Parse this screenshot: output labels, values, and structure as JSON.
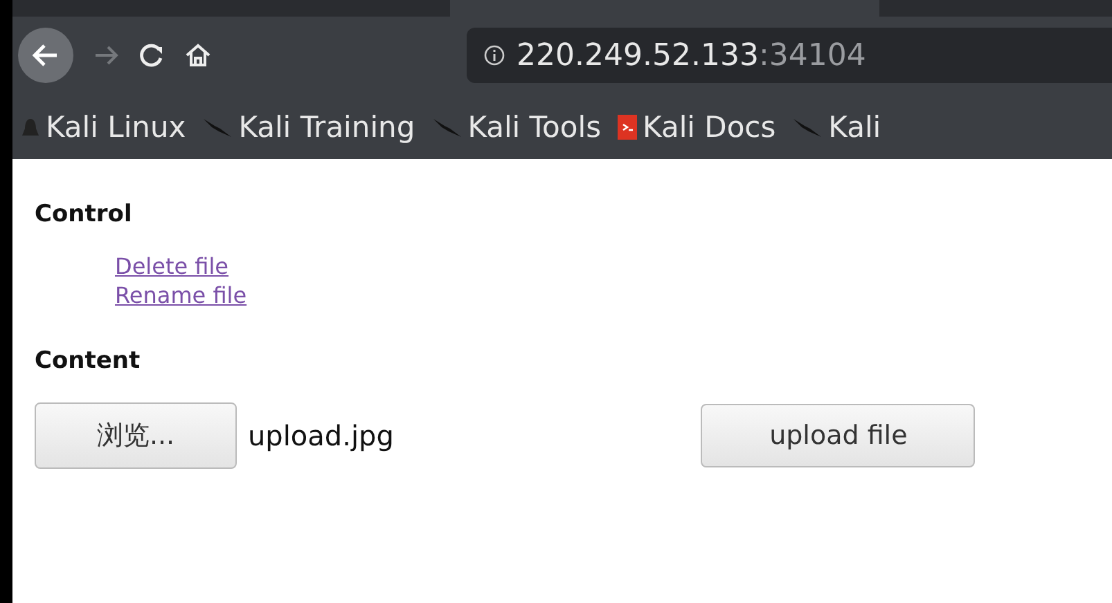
{
  "tabs": [
    {
      "selected": false
    },
    {
      "selected": true
    },
    {
      "selected": false
    }
  ],
  "address_bar": {
    "host": "220.249.52.133",
    "port": ":34104"
  },
  "bookmarks": [
    {
      "label": "Kali Linux",
      "kind": "penguin"
    },
    {
      "label": "Kali Training",
      "kind": "dragon"
    },
    {
      "label": "Kali Tools",
      "kind": "dragon"
    },
    {
      "label": "Kali Docs",
      "kind": "doc"
    },
    {
      "label": "Kali",
      "kind": "dragon"
    }
  ],
  "sections": [
    {
      "heading": "Control",
      "links": [
        "Delete file",
        "Rename file"
      ]
    },
    {
      "heading": "Content",
      "file_input": {
        "button": "浏览...",
        "filename": "upload.jpg"
      },
      "submit": "upload file"
    }
  ]
}
